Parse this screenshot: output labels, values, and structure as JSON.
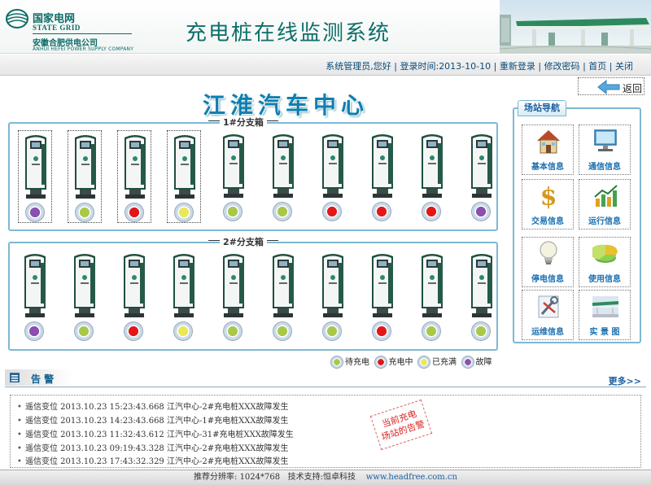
{
  "header": {
    "logo_cn": "国家电网",
    "logo_en": "STATE GRID",
    "company": "安徽合肥供电公司",
    "company_en": "ANHUI HEFEI POWER SUPPLY COMPANY",
    "app_title": "充电桩在线监测系统"
  },
  "infobar": {
    "user": "系统管理员,",
    "greeting": "您好",
    "login_time_label": "登录时间:",
    "login_time": "2013-10-10",
    "relogin": "重新登录",
    "change_password": "修改密码",
    "home": "首页",
    "close": "关闭",
    "sep": "|"
  },
  "back": {
    "label": "返回"
  },
  "center_title": "江淮汽车中心",
  "box1": {
    "title": "1#分支箱",
    "statuses": [
      "fault",
      "idle",
      "charging",
      "full",
      "idle",
      "idle",
      "charging",
      "charging",
      "charging",
      "fault"
    ]
  },
  "box2": {
    "title": "2#分支箱",
    "statuses": [
      "fault",
      "idle",
      "charging",
      "full",
      "idle",
      "idle",
      "idle",
      "charging",
      "idle",
      "idle"
    ]
  },
  "legend": [
    {
      "status": "idle",
      "label": "待充电"
    },
    {
      "status": "charging",
      "label": "充电中"
    },
    {
      "status": "full",
      "label": "已充满"
    },
    {
      "status": "fault",
      "label": "故障"
    }
  ],
  "status_colors": {
    "idle": "#a9c84a",
    "charging": "#e01818",
    "full": "#e8e85a",
    "fault": "#8a4fb0"
  },
  "nav": {
    "title": "场站导航",
    "items": [
      {
        "label": "基本信息",
        "icon": "house-icon"
      },
      {
        "label": "通信信息",
        "icon": "monitor-icon"
      },
      {
        "label": "交易信息",
        "icon": "dollar-icon"
      },
      {
        "label": "运行信息",
        "icon": "bar-chart-icon"
      },
      {
        "label": "停电信息",
        "icon": "lightbulb-icon"
      },
      {
        "label": "使用信息",
        "icon": "pie-chart-icon"
      },
      {
        "label": "运维信息",
        "icon": "wrench-icon"
      },
      {
        "label": "实 景 图",
        "icon": "photo-icon"
      }
    ]
  },
  "alarms": {
    "title": "告 警",
    "more": "更多>>",
    "rows": [
      "遥信变位 2013.10.23 15:23:43.668 江汽中心-2#充电桩XXX故障发生",
      "遥信变位 2013.10.23 14:23:43.668 江汽中心-1#充电桩XXX故障发生",
      "遥信变位 2013.10.23 11:32:43.612 江汽中心-31#充电桩XXX故障发生",
      "遥信变位 2013.10.23 09:19:43.328 江汽中心-2#充电桩XXX故障发生",
      "遥信变位 2013.10.23 17:43:32.329 江汽中心-2#充电桩XXX故障发生"
    ],
    "stamp_line1": "当前充电",
    "stamp_line2": "场站的告警"
  },
  "footer": {
    "resolution": "推荐分辨率: 1024*768",
    "support": "技术支持:恒卓科技",
    "url": "www.headfree.com.cn"
  }
}
